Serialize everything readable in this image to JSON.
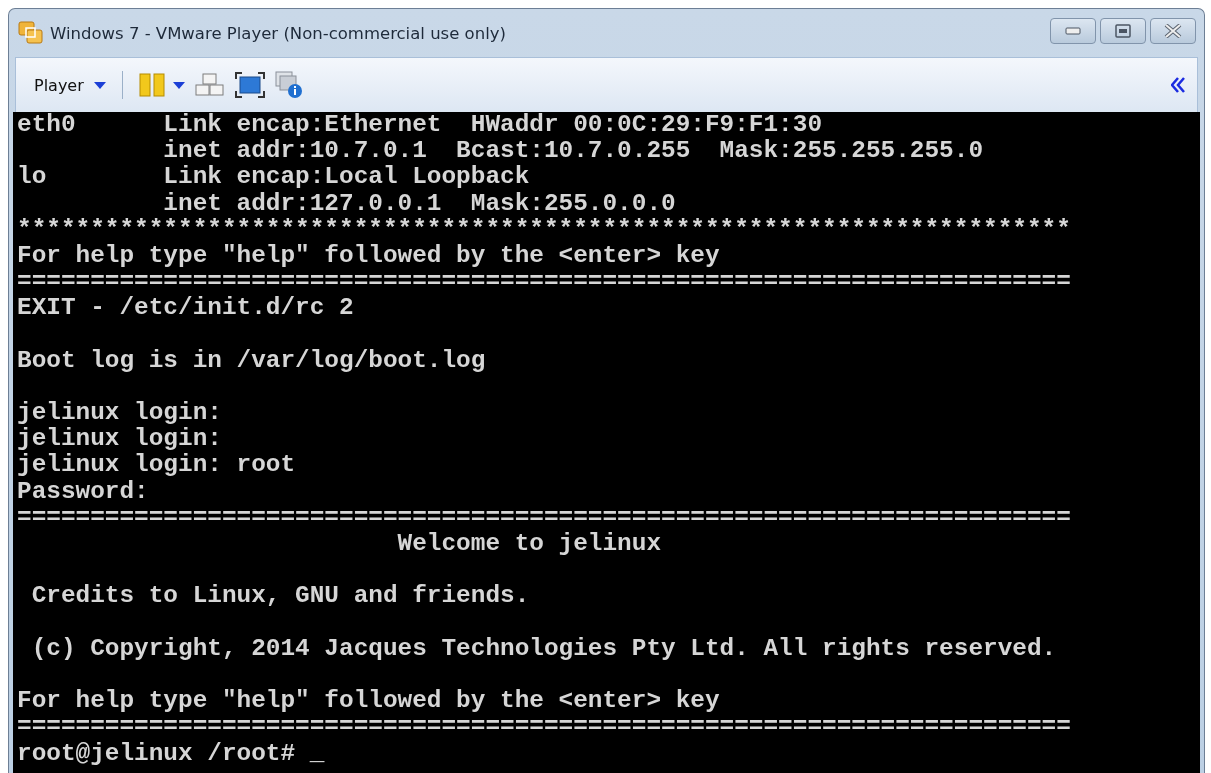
{
  "window": {
    "title": "Windows 7 - VMware Player (Non-commercial use only)"
  },
  "toolbar": {
    "menu_label": "Player"
  },
  "terminal": {
    "blocks": [
      {
        "lines": [
          "eth0      Link encap:Ethernet  HWaddr 00:0C:29:F9:F1:30",
          "          inet addr:10.7.0.1  Bcast:10.7.0.255  Mask:255.255.255.0",
          "lo        Link encap:Local Loopback",
          "          inet addr:127.0.0.1  Mask:255.0.0.0",
          "************************************************************************",
          "For help type \"help\" followed by the <enter> key",
          "========================================================================",
          "EXIT - /etc/init.d/rc 2"
        ]
      },
      {
        "lines": [
          "Boot log is in /var/log/boot.log"
        ]
      },
      {
        "lines": [
          "jelinux login:",
          "jelinux login:",
          "jelinux login: root",
          "Password:",
          "========================================================================",
          "                          Welcome to jelinux"
        ]
      },
      {
        "lines": [
          " Credits to Linux, GNU and friends."
        ]
      },
      {
        "lines": [
          " (c) Copyright, 2014 Jacques Technologies Pty Ltd. All rights reserved."
        ]
      },
      {
        "lines": [
          "For help type \"help\" followed by the <enter> key",
          "========================================================================"
        ]
      }
    ],
    "prompt": "root@jelinux /root# ",
    "cursor": "_"
  }
}
